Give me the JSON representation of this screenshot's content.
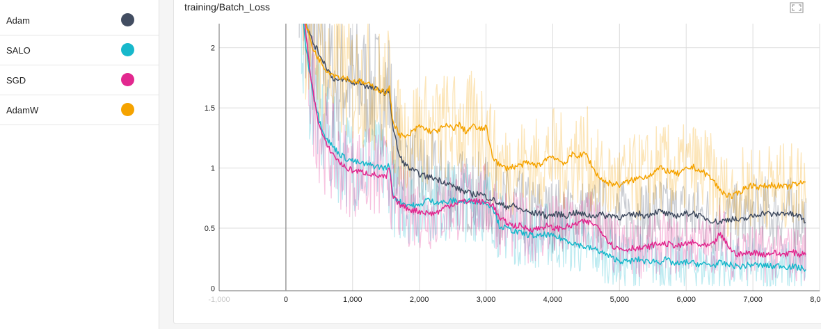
{
  "runs": [
    {
      "label": "Adam",
      "color": "#424d61"
    },
    {
      "label": "SALO",
      "color": "#17b8cb"
    },
    {
      "label": "SGD",
      "color": "#e2288f"
    },
    {
      "label": "AdamW",
      "color": "#f5a300"
    }
  ],
  "card": {
    "title": "training/Batch_Loss",
    "fullscreen_icon": "fullscreen-icon"
  },
  "chart_data": {
    "type": "line",
    "title": "training/Batch_Loss",
    "xlabel": "",
    "ylabel": "",
    "xlim": [
      -1000,
      8000
    ],
    "ylim": [
      -0.02,
      2.2
    ],
    "grid": true,
    "x_ticks": [
      -1000,
      0,
      1000,
      2000,
      3000,
      4000,
      5000,
      6000,
      7000,
      8000
    ],
    "x_tick_labels": [
      "-1,000",
      "0",
      "1,000",
      "2,000",
      "3,000",
      "4,000",
      "5,000",
      "6,000",
      "7,000",
      "8,000"
    ],
    "y_ticks": [
      0,
      0.5,
      1,
      1.5,
      2
    ],
    "y_tick_labels": [
      "0",
      "0.5",
      "1",
      "1.5",
      "2"
    ],
    "x": [
      200,
      300,
      400,
      500,
      600,
      700,
      800,
      900,
      1000,
      1100,
      1200,
      1300,
      1400,
      1500,
      1550,
      1600,
      1700,
      1800,
      1900,
      2000,
      2100,
      2200,
      2300,
      2400,
      2500,
      2600,
      2700,
      2800,
      2900,
      3000,
      3100,
      3200,
      3300,
      3400,
      3500,
      3600,
      3700,
      3800,
      3900,
      4000,
      4100,
      4200,
      4300,
      4400,
      4500,
      4600,
      4700,
      4800,
      4900,
      5000,
      5100,
      5200,
      5300,
      5400,
      5500,
      5600,
      5700,
      5800,
      5900,
      6000,
      6100,
      6200,
      6300,
      6400,
      6500,
      6600,
      6700,
      6800,
      6900,
      7000,
      7100,
      7200,
      7300,
      7400,
      7500,
      7600,
      7700,
      7800
    ],
    "series": [
      {
        "name": "Adam",
        "color": "#424d61",
        "values": [
          2.9,
          2.2,
          2.05,
          1.95,
          1.85,
          1.75,
          1.72,
          1.74,
          1.7,
          1.72,
          1.68,
          1.66,
          1.65,
          1.62,
          1.65,
          1.35,
          1.1,
          1.02,
          0.98,
          0.95,
          0.93,
          0.92,
          0.9,
          0.88,
          0.85,
          0.82,
          0.8,
          0.78,
          0.79,
          0.76,
          0.74,
          0.7,
          0.68,
          0.69,
          0.66,
          0.64,
          0.62,
          0.63,
          0.6,
          0.61,
          0.62,
          0.6,
          0.63,
          0.62,
          0.61,
          0.6,
          0.62,
          0.6,
          0.61,
          0.59,
          0.6,
          0.61,
          0.62,
          0.6,
          0.63,
          0.64,
          0.62,
          0.6,
          0.61,
          0.62,
          0.63,
          0.6,
          0.58,
          0.56,
          0.55,
          0.57,
          0.58,
          0.56,
          0.58,
          0.6,
          0.62,
          0.63,
          0.61,
          0.62,
          0.63,
          0.61,
          0.6,
          0.55
        ]
      },
      {
        "name": "SALO",
        "color": "#17b8cb",
        "values": [
          2.6,
          2.0,
          1.65,
          1.4,
          1.25,
          1.18,
          1.12,
          1.08,
          1.06,
          1.04,
          1.03,
          1.02,
          1.01,
          1.0,
          1.03,
          0.78,
          0.72,
          0.7,
          0.69,
          0.68,
          0.74,
          0.72,
          0.72,
          0.71,
          0.73,
          0.72,
          0.72,
          0.73,
          0.72,
          0.71,
          0.68,
          0.52,
          0.5,
          0.48,
          0.46,
          0.45,
          0.44,
          0.43,
          0.45,
          0.43,
          0.42,
          0.4,
          0.38,
          0.36,
          0.34,
          0.33,
          0.31,
          0.28,
          0.25,
          0.23,
          0.22,
          0.23,
          0.24,
          0.22,
          0.23,
          0.22,
          0.24,
          0.21,
          0.2,
          0.22,
          0.21,
          0.2,
          0.2,
          0.19,
          0.21,
          0.2,
          0.19,
          0.18,
          0.19,
          0.2,
          0.19,
          0.19,
          0.18,
          0.19,
          0.18,
          0.18,
          0.17,
          0.16
        ]
      },
      {
        "name": "SGD",
        "color": "#e2288f",
        "values": [
          2.7,
          2.1,
          1.65,
          1.35,
          1.2,
          1.12,
          1.05,
          1.0,
          0.98,
          0.97,
          0.96,
          0.95,
          0.93,
          0.92,
          1.0,
          0.76,
          0.7,
          0.67,
          0.65,
          0.64,
          0.63,
          0.62,
          0.64,
          0.68,
          0.7,
          0.72,
          0.72,
          0.73,
          0.72,
          0.71,
          0.7,
          0.58,
          0.55,
          0.52,
          0.52,
          0.5,
          0.49,
          0.5,
          0.52,
          0.5,
          0.5,
          0.51,
          0.52,
          0.55,
          0.55,
          0.54,
          0.5,
          0.42,
          0.35,
          0.33,
          0.32,
          0.34,
          0.33,
          0.34,
          0.36,
          0.37,
          0.37,
          0.36,
          0.35,
          0.37,
          0.38,
          0.36,
          0.35,
          0.36,
          0.45,
          0.38,
          0.3,
          0.28,
          0.29,
          0.3,
          0.29,
          0.28,
          0.3,
          0.28,
          0.29,
          0.3,
          0.28,
          0.3
        ]
      },
      {
        "name": "AdamW",
        "color": "#f5a300",
        "values": [
          2.9,
          2.2,
          2.0,
          1.9,
          1.82,
          1.78,
          1.76,
          1.75,
          1.72,
          1.72,
          1.7,
          1.68,
          1.65,
          1.62,
          1.66,
          1.4,
          1.28,
          1.25,
          1.3,
          1.35,
          1.32,
          1.3,
          1.32,
          1.35,
          1.33,
          1.36,
          1.3,
          1.35,
          1.32,
          1.34,
          1.1,
          1.02,
          1.0,
          1.01,
          1.02,
          1.04,
          1.03,
          1.02,
          1.08,
          1.1,
          1.06,
          1.04,
          1.12,
          1.1,
          1.12,
          1.0,
          0.92,
          0.88,
          0.87,
          0.86,
          0.88,
          0.9,
          0.92,
          0.93,
          0.96,
          1.0,
          0.98,
          0.96,
          0.95,
          0.99,
          1.01,
          0.98,
          0.95,
          0.9,
          0.82,
          0.78,
          0.76,
          0.8,
          0.84,
          0.86,
          0.84,
          0.85,
          0.86,
          0.85,
          0.84,
          0.86,
          0.87,
          0.88
        ]
      }
    ]
  }
}
